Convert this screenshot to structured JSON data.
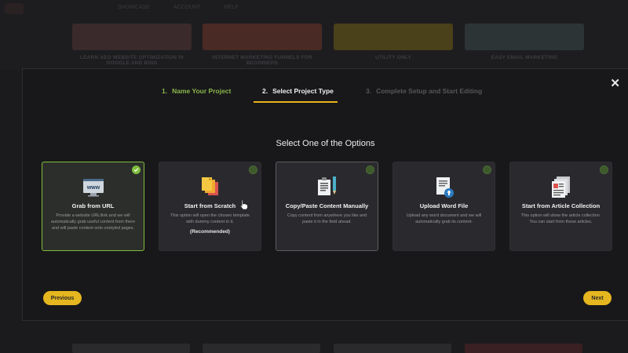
{
  "background": {
    "nav_items": [
      "SHOWCASE",
      "ACCOUNT",
      "HELP"
    ],
    "card_captions": [
      "LEARN SEO WEBSITE OPTIMIZATION IN GOOGLE AND BING",
      "INTERNET MARKETING FUNNELS FOR BEGINNERS",
      "UTILITY ONLY",
      "EASY EMAIL MARKETING"
    ]
  },
  "modal": {
    "close_symbol": "✕",
    "steps": [
      {
        "num": "1.",
        "label": "Name Your Project",
        "state": "done"
      },
      {
        "num": "2.",
        "label": "Select Project Type",
        "state": "active"
      },
      {
        "num": "3.",
        "label": "Complete Setup and Start Editing",
        "state": "pending"
      }
    ],
    "heading": "Select One of the Options",
    "options": [
      {
        "title": "Grab from URL",
        "desc": "Provide a website URL/link and we will automatically grab useful content from there and will paste content onto unstyled pages.",
        "icon": "www-browser-icon",
        "selected": true
      },
      {
        "title": "Start from Scratch",
        "desc": "This option will open the chosen template with dummy content in it.",
        "note": "(Recommended)",
        "icon": "stacked-pages-icon",
        "selected": false
      },
      {
        "title": "Copy/Paste Content Manually",
        "desc": "Copy content from anywhere you like and paste it in the field ahead.",
        "icon": "document-pen-icon",
        "selected": false
      },
      {
        "title": "Upload Word File",
        "desc": "Upload any word document and we will automatically grab its content.",
        "icon": "word-upload-icon",
        "selected": false
      },
      {
        "title": "Start from Article Collection",
        "desc": "This option will show the article collection. You can start from those articles.",
        "icon": "article-collection-icon",
        "selected": false
      }
    ],
    "previous_label": "Previous",
    "next_label": "Next"
  },
  "colors": {
    "accent_yellow": "#e5b61f",
    "success_green": "#7fbe3c",
    "modal_bg": "#18181a",
    "card_bg": "#2a2a2e"
  }
}
